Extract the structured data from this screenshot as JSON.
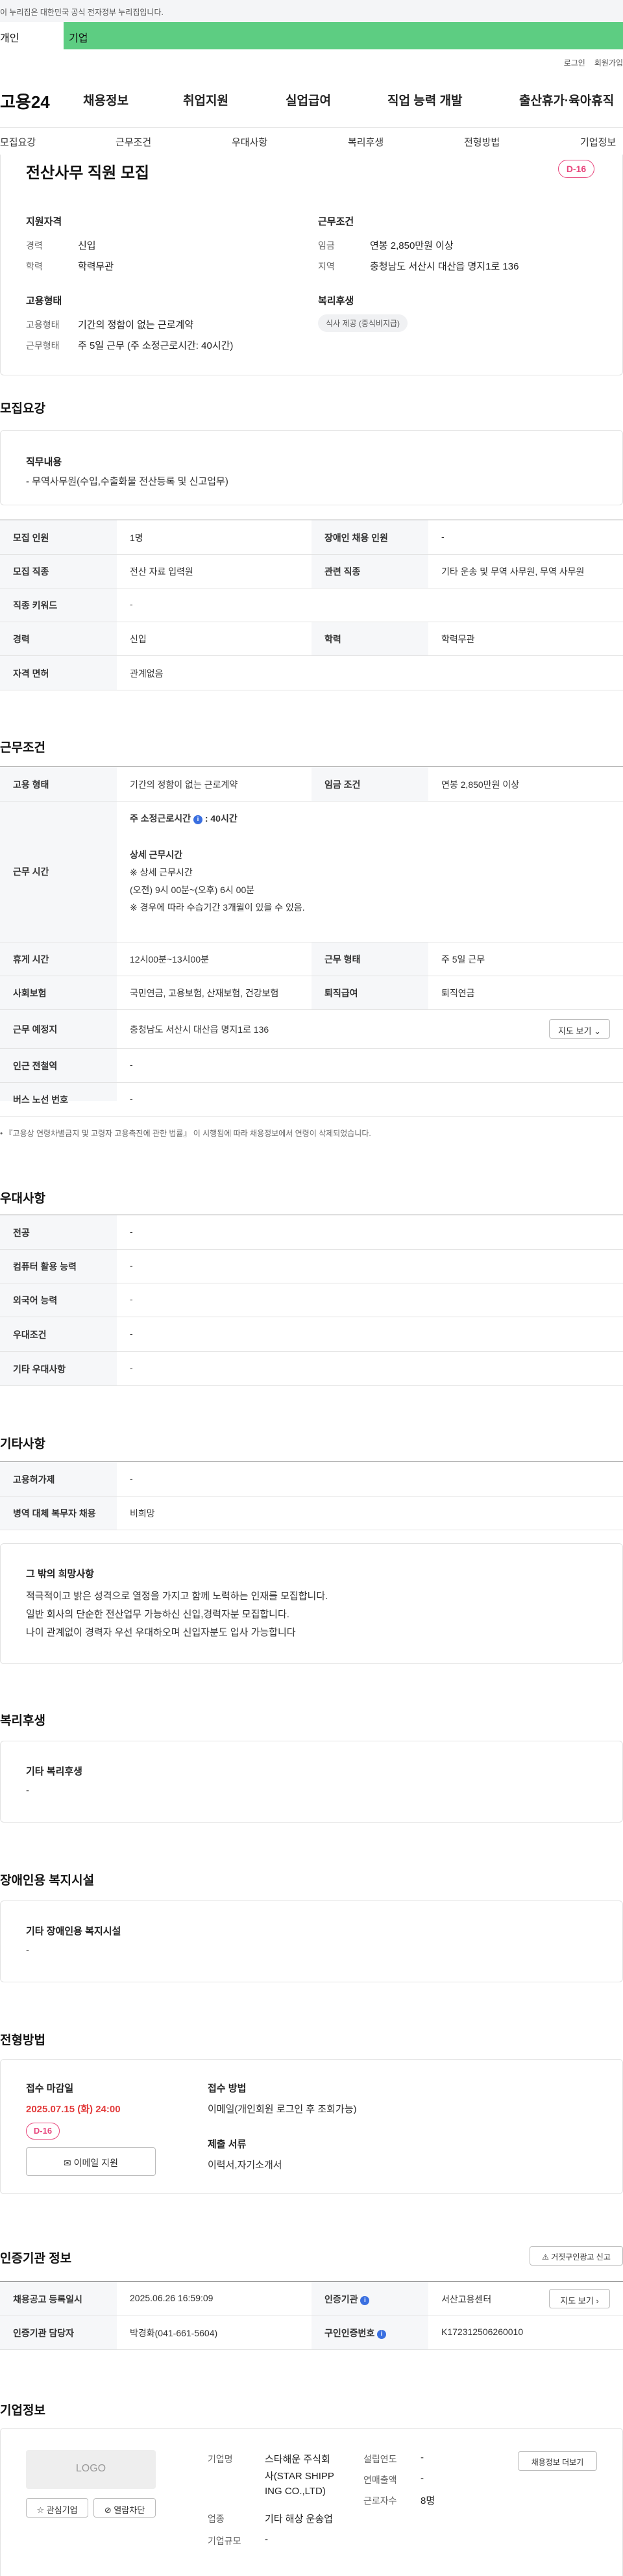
{
  "gov_banner": "이 누리집은 대한민국 공식 전자정부 누리집입니다.",
  "site_tabs": {
    "personal": "개인",
    "company": "기업"
  },
  "util": {
    "login": "로그인",
    "join": "회원가입"
  },
  "logo": "고용24",
  "gnb": [
    "채용정보",
    "취업지원",
    "실업급여",
    "직업 능력 개발",
    "출산휴가·육아휴직"
  ],
  "subnav": [
    "모집요강",
    "근무조건",
    "우대사항",
    "복리후생",
    "전형방법",
    "기업정보"
  ],
  "job": {
    "title": "전산사무 직원 모집",
    "dday": "D-16",
    "qualification": {
      "heading": "지원자격",
      "career_label": "경력",
      "career": "신입",
      "edu_label": "학력",
      "edu": "학력무관"
    },
    "conditions": {
      "heading": "근무조건",
      "wage_label": "임금",
      "wage": "연봉 2,850만원 이상",
      "region_label": "지역",
      "region": "충청남도 서산시 대산읍 명지1로 136"
    },
    "employment": {
      "heading": "고용형태",
      "type_label": "고용형태",
      "type": "기간의 정함이 없는 근로계약",
      "hours_label": "근무형태",
      "hours": "주 5일 근무 (주 소정근로시간: 40시간)"
    },
    "welfare": {
      "heading": "복리후생",
      "chip": "식사 제공 (중식비지급)"
    }
  },
  "recruit": {
    "title": "모집요강",
    "duty_label": "직무내용",
    "duty": "- 무역사무원(수입,수출화물 전산등록 및 신고업무)",
    "rows": [
      {
        "h1": "모집 인원",
        "v1": "1명",
        "h2": "장애인 채용 인원",
        "v2": "-"
      },
      {
        "h1": "모집 직종",
        "v1": "전산 자료 입력원",
        "h2": "관련 직종",
        "v2": "기타 운송 및 무역 사무원, 무역 사무원"
      },
      {
        "h1": "직종 키워드",
        "v1": "-"
      },
      {
        "h1": "경력",
        "v1": "신입",
        "h2": "학력",
        "v2": "학력무관"
      },
      {
        "h1": "자격 면허",
        "v1": "관계없음"
      }
    ]
  },
  "work": {
    "title": "근무조건",
    "row1": {
      "h1": "고용 형태",
      "v1": "기간의 정함이 없는 근로계약",
      "h2": "임금 조건",
      "v2": "연봉 2,850만원 이상"
    },
    "hours_label": "근무 시간",
    "weekly_label": "주 소정근로시간",
    "weekly_value": ": 40시간",
    "detail_label": "상세 근무시간",
    "detail_lines": [
      "※ 상세 근무시간",
      "(오전) 9시 00분~(오후) 6시 00분",
      "※ 경우에 따라 수습기간 3개월이 있을 수 있음."
    ],
    "row3": {
      "h1": "휴게 시간",
      "v1": "12시00분~13시00분",
      "h2": "근무 형태",
      "v2": "주 5일 근무"
    },
    "row4": {
      "h1": "사회보험",
      "v1": "국민연금, 고용보험, 산재보험, 건강보험",
      "h2": "퇴직급여",
      "v2": "퇴직연금"
    },
    "row5": {
      "h1": "근무 예정지",
      "v1": "충청남도 서산시 대산읍 명지1로 136",
      "btn": "지도 보기"
    },
    "row6": {
      "h1": "인근 전철역",
      "v1": "-"
    },
    "row7": {
      "h1": "버스 노선 번호",
      "v1": "-"
    },
    "note": "『고용상 연령차별금지 및 고령자 고용촉진에 관한 법률』 이 시행됨에 따라 채용정보에서 연령이 삭제되었습니다."
  },
  "pref": {
    "title": "우대사항",
    "rows": [
      {
        "h": "전공",
        "v": "-"
      },
      {
        "h": "컴퓨터 활용 능력",
        "v": "-"
      },
      {
        "h": "외국어 능력",
        "v": "-"
      },
      {
        "h": "우대조건",
        "v": "-"
      },
      {
        "h": "기타 우대사항",
        "v": "-"
      }
    ]
  },
  "etc": {
    "title": "기타사항",
    "rows": [
      {
        "h": "고용허가제",
        "v": "-"
      },
      {
        "h": "병역 대체 복무자 채용",
        "v": "비희망"
      }
    ],
    "other_label": "그 밖의 희망사항",
    "other_lines": [
      "적극적이고 밝은 성격으로 열정을 가지고 함께 노력하는 인재를 모집합니다.",
      "일반 회사의 단순한 전산업무 가능하신 신입,경력자분 모집합니다.",
      "나이 관계없이 경력자 우선 우대하오며 신입자분도 입사 가능합니다"
    ]
  },
  "welfare": {
    "title": "복리후생",
    "label": "기타 복리후생",
    "value": "-"
  },
  "disability": {
    "title": "장애인용 복지시설",
    "label": "기타 장애인용 복지시설",
    "value": "-"
  },
  "selection": {
    "title": "전형방법",
    "deadline_label": "접수 마감일",
    "deadline": "2025.07.15 (화) 24:00",
    "dday": "D-16",
    "email_btn": "이메일 지원",
    "method_label": "접수 방법",
    "method": "이메일(개인회원 로그인 후 조회가능)",
    "docs_label": "제출 서류",
    "docs": "이력서,자기소개서"
  },
  "cert": {
    "title": "인증기관 정보",
    "report_btn": "거짓구인광고 신고",
    "row1": {
      "h1": "채용공고 등록일시",
      "v1": "2025.06.26 16:59:09",
      "h2": "인증기관",
      "v2": "서산고용센터",
      "btn": "지도 보기"
    },
    "row2": {
      "h1": "인증기관 담당자",
      "v1": "박경화(041-661-5604)",
      "h2": "구인인증번호",
      "v2": "K172312506260010"
    }
  },
  "company": {
    "title": "기업정보",
    "logo_text": "LOGO",
    "fav_btn": "관심기업",
    "block_btn": "열람차단",
    "name_label": "기업명",
    "name_lines": [
      "스타해운 주식회",
      "사(STAR SHIPP",
      "ING CO.,LTD)"
    ],
    "industry_label": "업종",
    "industry": "기타 해상 운송업",
    "scale_label": "기업규모",
    "scale": "-",
    "year_label": "설립연도",
    "year": "-",
    "sales_label": "연매출액",
    "sales": "-",
    "emp_label": "근로자수",
    "emp": "8명",
    "more_btn": "채용정보 더보기"
  },
  "colors": {
    "brand_green": "#5dcd82",
    "dday_pink": "#e8457c",
    "deadline_red": "#e23c3c",
    "info_blue": "#3a6fe0"
  }
}
